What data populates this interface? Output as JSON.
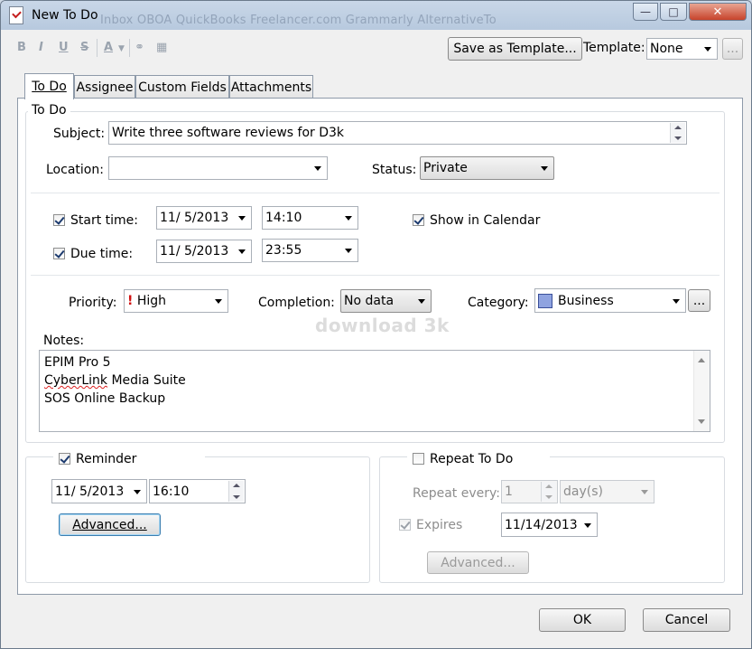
{
  "window": {
    "title": "New To Do",
    "minimize_icon": "minimize-icon",
    "maximize_icon": "maximize-icon",
    "close_icon": "close-icon"
  },
  "background_taskbar_text": "Inbox  OBOA  QuickBooks  Freelancer.com  Grammarly  AlternativeTo",
  "toolbar": {
    "format_icons": [
      "bold-icon",
      "italic-icon",
      "underline-icon",
      "strikethrough-icon",
      "font-color-icon",
      "link-icon",
      "calendar-icon"
    ],
    "save_template_label": "Save as Template...",
    "template_label": "Template:",
    "template_value": "None",
    "more_label": "..."
  },
  "tabs": [
    {
      "label": "To Do",
      "active": true
    },
    {
      "label": "Assignee",
      "active": false
    },
    {
      "label": "Custom Fields",
      "active": false
    },
    {
      "label": "Attachments",
      "active": false
    }
  ],
  "todo": {
    "group_title": "To Do",
    "subject_label": "Subject:",
    "subject_value": "Write three software reviews for D3k",
    "location_label": "Location:",
    "location_value": "",
    "status_label": "Status:",
    "status_value": "Private",
    "start_time_label": "Start time:",
    "start_time_checked": true,
    "start_date": "11/  5/2013",
    "start_clock": "14:10",
    "due_time_label": "Due time:",
    "due_time_checked": true,
    "due_date": "11/  5/2013",
    "due_clock": "23:55",
    "show_calendar_label": "Show in Calendar",
    "show_calendar_checked": true,
    "priority_label": "Priority:",
    "priority_value": "High",
    "completion_label": "Completion:",
    "completion_value": "No data",
    "category_label": "Category:",
    "category_value": "Business",
    "category_color": "#8fa3e0",
    "category_more": "...",
    "notes_label": "Notes:",
    "notes_lines": [
      "EPIM Pro 5",
      "CyberLink Media Suite",
      "SOS Online Backup"
    ]
  },
  "watermark": "download 3k",
  "reminder": {
    "label": "Reminder",
    "checked": true,
    "date": "11/  5/2013",
    "time": "16:10",
    "advanced_label": "Advanced..."
  },
  "repeat": {
    "label": "Repeat To Do",
    "checked": false,
    "every_label": "Repeat every:",
    "every_value": "1",
    "unit_value": "day(s)",
    "expires_label": "Expires",
    "expires_checked": true,
    "expires_date": "11/14/2013",
    "advanced_label": "Advanced..."
  },
  "footer": {
    "ok_label": "OK",
    "cancel_label": "Cancel"
  }
}
